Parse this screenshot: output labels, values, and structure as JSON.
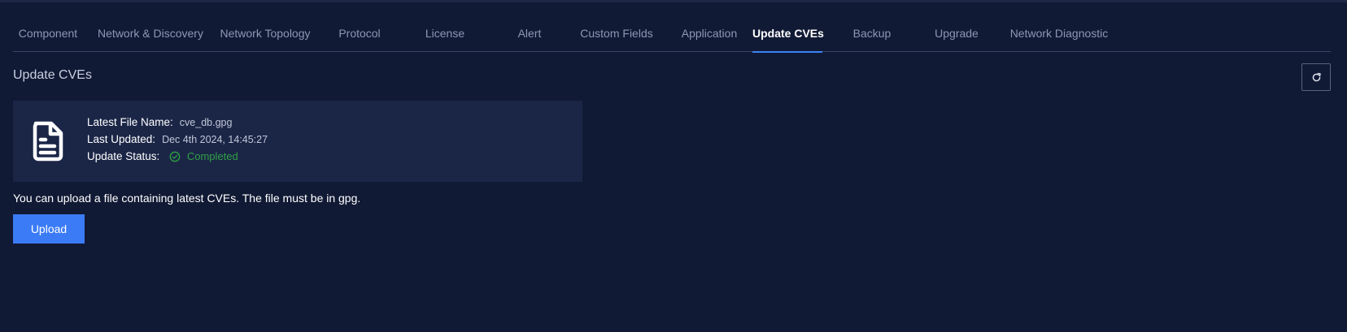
{
  "tabs": [
    {
      "label": "Component"
    },
    {
      "label": "Network & Discovery"
    },
    {
      "label": "Network Topology"
    },
    {
      "label": "Protocol"
    },
    {
      "label": "License"
    },
    {
      "label": "Alert"
    },
    {
      "label": "Custom Fields"
    },
    {
      "label": "Application"
    },
    {
      "label": "Update CVEs"
    },
    {
      "label": "Backup"
    },
    {
      "label": "Upgrade"
    },
    {
      "label": "Network Diagnostic"
    }
  ],
  "active_tab": "Update CVEs",
  "page_title": "Update CVEs",
  "refresh_icon": "refresh-icon",
  "file_info": {
    "icon": "document-icon",
    "latest_file_label": "Latest File Name:",
    "latest_file_value": "cve_db.gpg",
    "last_updated_label": "Last Updated:",
    "last_updated_value": "Dec 4th 2024, 14:45:27",
    "status_label": "Update Status:",
    "status_value": "Completed",
    "status_color": "#2ea043"
  },
  "hint_text": "You can upload a file containing latest CVEs. The file must be in gpg.",
  "upload_label": "Upload",
  "colors": {
    "background": "#111a35",
    "card": "#1b2647",
    "accent": "#3b7bf6"
  }
}
